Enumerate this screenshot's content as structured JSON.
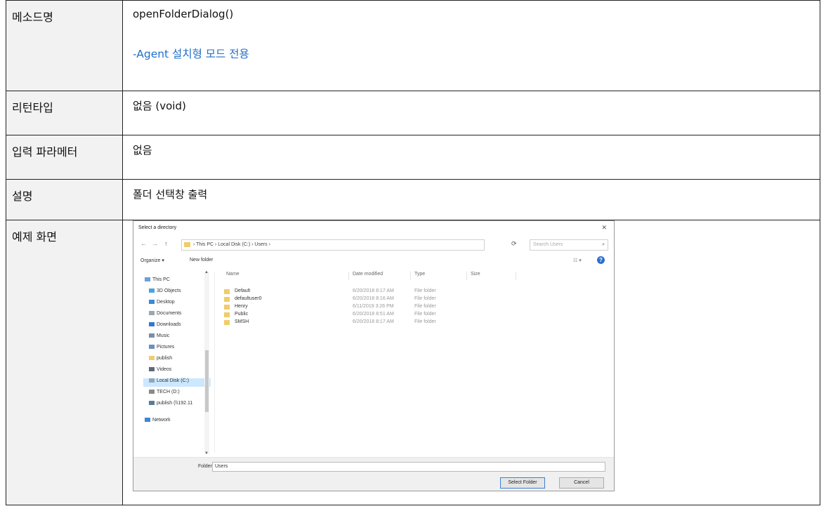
{
  "rows": [
    {
      "label": "메소드명",
      "value": "openFolderDialog()",
      "note": "-Agent 설치형 모드 전용"
    },
    {
      "label": "리턴타입",
      "value": "없음 (void)"
    },
    {
      "label": "입력 파라메터",
      "value": "없음"
    },
    {
      "label": "설명",
      "value": "폴더 선택창 출력"
    },
    {
      "label": "예제 화면"
    }
  ],
  "dialog": {
    "title": "Select a directory",
    "close": "✕",
    "nav": {
      "back": "←",
      "forward": "→",
      "up": "↑"
    },
    "breadcrumb": "› This PC › Local Disk (C:) › Users ›",
    "refresh": "⟳",
    "search_placeholder": "Search Users",
    "toolbar": {
      "organize": "Organize ▾",
      "new_folder": "New folder",
      "view": "☷ ▾",
      "help": "?"
    },
    "nav_items": [
      {
        "label": "This PC",
        "color": "#6aa0d8"
      },
      {
        "label": "3D Objects",
        "color": "#4aa3df"
      },
      {
        "label": "Desktop",
        "color": "#3a8ad4"
      },
      {
        "label": "Documents",
        "color": "#9aa6b4"
      },
      {
        "label": "Downloads",
        "color": "#2f7ad0"
      },
      {
        "label": "Music",
        "color": "#7a8ea6"
      },
      {
        "label": "Pictures",
        "color": "#6f8fb8"
      },
      {
        "label": "publish",
        "color": "#f0cd6a"
      },
      {
        "label": "Videos",
        "color": "#5b6a7c"
      },
      {
        "label": "Local Disk (C:)",
        "color": "#8fa6bf"
      },
      {
        "label": "TECH (D:)",
        "color": "#8a8a8a"
      },
      {
        "label": "publish (\\\\192.11",
        "color": "#5c7a9c"
      },
      {
        "label": "Network",
        "color": "#3f86d6"
      }
    ],
    "columns": {
      "name": "Name",
      "date": "Date modified",
      "type": "Type",
      "size": "Size"
    },
    "files": [
      {
        "name": "Default",
        "date": "6/20/2018 8:17 AM",
        "type": "File folder"
      },
      {
        "name": "defaultuser0",
        "date": "6/20/2018 8:16 AM",
        "type": "File folder"
      },
      {
        "name": "Henry",
        "date": "6/11/2019 3:26 PM",
        "type": "File folder"
      },
      {
        "name": "Public",
        "date": "6/20/2018 8:51 AM",
        "type": "File folder"
      },
      {
        "name": "SMSH",
        "date": "6/20/2018 8:17 AM",
        "type": "File folder"
      }
    ],
    "folder_label": "Folder:",
    "folder_value": "Users",
    "select_button": "Select Folder",
    "cancel_button": "Cancel"
  }
}
